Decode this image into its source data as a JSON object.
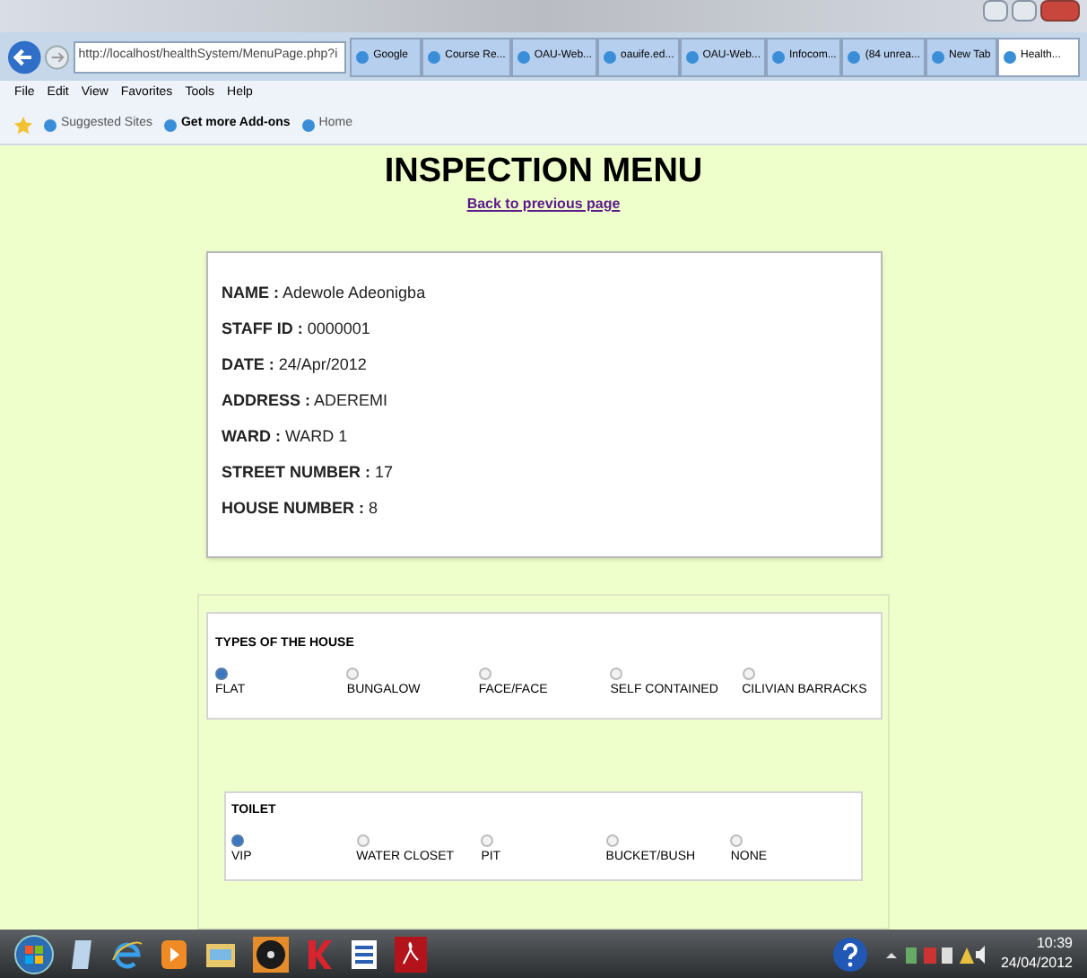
{
  "browser": {
    "address": "http://localhost/healthSystem/MenuPage.php?i",
    "tabs": [
      {
        "label": "Google",
        "selected": false
      },
      {
        "label": "Course Re...",
        "selected": false
      },
      {
        "label": "OAU-Web...",
        "selected": false
      },
      {
        "label": "oauife.ed...",
        "selected": false
      },
      {
        "label": "OAU-Web...",
        "selected": false
      },
      {
        "label": "Infocom...",
        "selected": false
      },
      {
        "label": "(84 unrea...",
        "selected": false
      },
      {
        "label": "New Tab",
        "selected": false
      },
      {
        "label": "Health...",
        "selected": true
      }
    ],
    "menu": [
      "File",
      "Edit",
      "View",
      "Favorites",
      "Tools",
      "Help"
    ],
    "favorites": [
      {
        "label": "Suggested Sites",
        "bold": false
      },
      {
        "label": "Get more Add-ons",
        "bold": true
      },
      {
        "label": "Home",
        "bold": false
      }
    ]
  },
  "page": {
    "title": "INSPECTION MENU",
    "back_link": "Back to previous page",
    "info": [
      {
        "label": "NAME :",
        "value": "Adewole Adeonigba"
      },
      {
        "label": "STAFF ID :",
        "value": "0000001"
      },
      {
        "label": "DATE :",
        "value": "24/Apr/2012"
      },
      {
        "label": "ADDRESS :",
        "value": "ADEREMI"
      },
      {
        "label": "WARD :",
        "value": "WARD 1"
      },
      {
        "label": "STREET NUMBER :",
        "value": "17"
      },
      {
        "label": "HOUSE NUMBER :",
        "value": "8"
      }
    ],
    "groups": [
      {
        "title": "TYPES OF THE HOUSE",
        "options": [
          {
            "label": "FLAT",
            "selected": true
          },
          {
            "label": "BUNGALOW",
            "selected": false
          },
          {
            "label": "FACE/FACE",
            "selected": false
          },
          {
            "label": "SELF CONTAINED",
            "selected": false
          },
          {
            "label": "CILIVIAN BARRACKS",
            "selected": false
          }
        ]
      },
      {
        "title": "TOILET",
        "options": [
          {
            "label": "VIP",
            "selected": true
          },
          {
            "label": "WATER CLOSET",
            "selected": false
          },
          {
            "label": "PIT",
            "selected": false
          },
          {
            "label": "BUCKET/BUSH",
            "selected": false
          },
          {
            "label": "NONE",
            "selected": false
          }
        ]
      }
    ]
  },
  "taskbar": {
    "time": "10:39",
    "date": "24/04/2012"
  }
}
